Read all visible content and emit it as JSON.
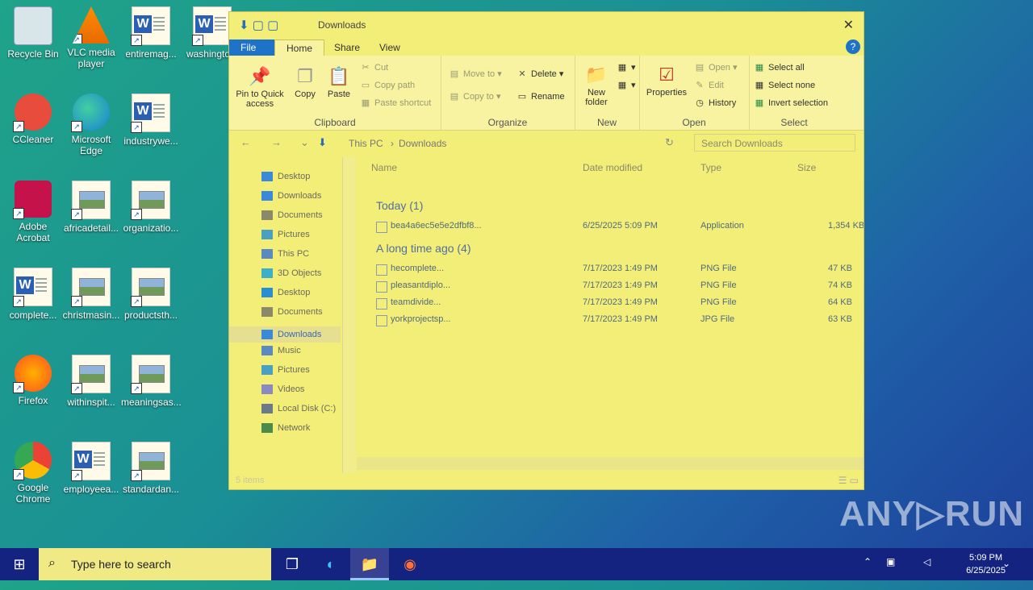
{
  "desktop": {
    "icons": [
      {
        "label": "Recycle Bin",
        "icon": "recycle-bin-icon"
      },
      {
        "label": "VLC media player",
        "icon": "vlc-icon"
      },
      {
        "label": "entiremag...",
        "icon": "word-doc-icon"
      },
      {
        "label": "washingto...",
        "icon": "word-doc-icon"
      },
      {
        "label": "CCleaner",
        "icon": "ccleaner-icon"
      },
      {
        "label": "Microsoft Edge",
        "icon": "edge-icon"
      },
      {
        "label": "industrywe...",
        "icon": "word-doc-icon"
      },
      {
        "label": "Adobe Acrobat",
        "icon": "acrobat-icon"
      },
      {
        "label": "africadetail...",
        "icon": "image-file-icon"
      },
      {
        "label": "organizatio...",
        "icon": "image-file-icon"
      },
      {
        "label": "complete...",
        "icon": "word-doc-icon"
      },
      {
        "label": "christmasin...",
        "icon": "image-file-icon"
      },
      {
        "label": "productsth...",
        "icon": "image-file-icon"
      },
      {
        "label": "Firefox",
        "icon": "firefox-icon"
      },
      {
        "label": "withinspit...",
        "icon": "image-file-icon"
      },
      {
        "label": "meaningsas...",
        "icon": "image-file-icon"
      },
      {
        "label": "Google Chrome",
        "icon": "chrome-icon"
      },
      {
        "label": "employeea...",
        "icon": "word-doc-icon"
      },
      {
        "label": "standardan...",
        "icon": "image-file-icon"
      }
    ]
  },
  "window": {
    "title": "Downloads",
    "tabs": {
      "file": "File",
      "home": "Home",
      "share": "Share",
      "view": "View"
    },
    "help": "?",
    "ribbon": {
      "clipboard": {
        "label": "Clipboard",
        "pin": "Pin to Quick access",
        "copy": "Copy",
        "paste": "Paste",
        "cut": "Cut",
        "copy_path": "Copy path",
        "paste_shortcut": "Paste shortcut"
      },
      "organize": {
        "label": "Organize",
        "move_to": "Move to",
        "copy_to": "Copy to",
        "delete": "Delete",
        "rename": "Rename"
      },
      "new": {
        "label": "New",
        "new_folder": "New folder"
      },
      "open": {
        "label": "Open",
        "properties": "Properties",
        "open": "Open",
        "edit": "Edit",
        "history": "History"
      },
      "select": {
        "label": "Select",
        "select_all": "Select all",
        "select_none": "Select none",
        "invert": "Invert selection"
      }
    },
    "address": {
      "crumbs": [
        "This PC",
        "Downloads"
      ],
      "search_placeholder": "Search Downloads"
    },
    "nav_pane": {
      "items": [
        "Desktop",
        "Downloads",
        "Documents",
        "Pictures",
        "This PC",
        "3D Objects",
        "Desktop",
        "Documents",
        "Downloads",
        "Music",
        "Pictures",
        "Videos",
        "Local Disk (C:)",
        "Network"
      ],
      "selected": "Downloads"
    },
    "columns": {
      "name": "Name",
      "date": "Date modified",
      "type": "Type",
      "size": "Size"
    },
    "groups": [
      {
        "header": "Today (1)",
        "rows": [
          {
            "name": "bea4a6ec5e5e2dfbf8...",
            "date": "6/25/2025 5:09 PM",
            "type": "Application",
            "size": "1,354 KB"
          }
        ]
      },
      {
        "header": "A long time ago (4)",
        "rows": [
          {
            "name": "hecomplete...",
            "date": "7/17/2023 1:49 PM",
            "type": "PNG File",
            "size": "47 KB"
          },
          {
            "name": "pleasantdiplo...",
            "date": "7/17/2023 1:49 PM",
            "type": "PNG File",
            "size": "74 KB"
          },
          {
            "name": "teamdivide...",
            "date": "7/17/2023 1:49 PM",
            "type": "PNG File",
            "size": "64 KB"
          },
          {
            "name": "yorkprojectsp...",
            "date": "7/17/2023 1:49 PM",
            "type": "JPG File",
            "size": "63 KB"
          }
        ]
      }
    ],
    "status": "5 items"
  },
  "taskbar": {
    "search_placeholder": "Type here to search",
    "time": "5:09 PM",
    "date": "6/25/2025"
  },
  "watermark": "ANY▷RUN"
}
